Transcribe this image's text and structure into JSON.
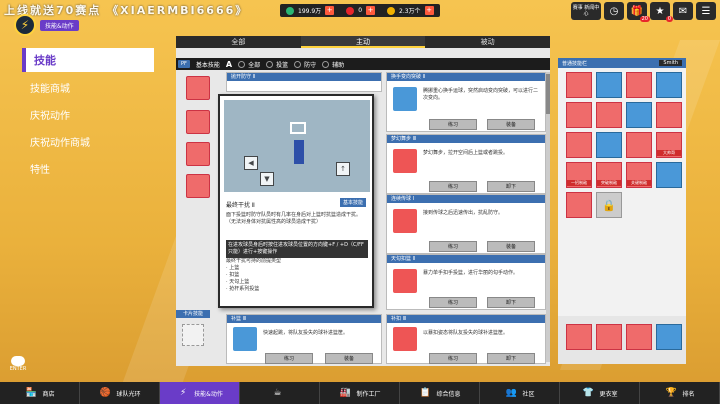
{
  "watermark": "上线就送70赛点 《XIAERMBI6666》",
  "logo": {
    "glyph": "⚡",
    "subtitle": "技能&动作"
  },
  "currencies": [
    {
      "value": "199.9万",
      "color": "#2bb673",
      "add_label": "+"
    },
    {
      "value": "0",
      "color": "#e8252b",
      "add_label": "+"
    },
    {
      "value": "2.3万个",
      "color": "#f0b000",
      "add_label": "+"
    }
  ],
  "top_icons": [
    {
      "name": "league-icon",
      "glyph": "赛事\n新闻中心",
      "badge": ""
    },
    {
      "name": "clock-icon",
      "glyph": "◷",
      "badge": ""
    },
    {
      "name": "gift-icon",
      "glyph": "🎁",
      "badge": "20"
    },
    {
      "name": "reward-icon",
      "glyph": "★",
      "badge": "0"
    },
    {
      "name": "mail-icon",
      "glyph": "✉",
      "badge": ""
    },
    {
      "name": "menu-icon",
      "glyph": "☰",
      "badge": ""
    }
  ],
  "sidebar": {
    "items": [
      {
        "label": "技能",
        "active": true
      },
      {
        "label": "技能商城",
        "active": false
      },
      {
        "label": "庆祝动作",
        "active": false
      },
      {
        "label": "庆祝动作商城",
        "active": false
      },
      {
        "label": "特性",
        "active": false
      }
    ]
  },
  "tabs": [
    {
      "label": "全部",
      "active": false
    },
    {
      "label": "主动",
      "active": true
    },
    {
      "label": "被动",
      "active": false
    }
  ],
  "filter": {
    "base_label": "基本技能",
    "letter": "A",
    "items": [
      "全部",
      "投篮",
      "防守",
      "辅助"
    ]
  },
  "cards": [
    {
      "header": "抛开防守 Ⅱ",
      "desc": "",
      "btn1": "练习",
      "btn2": "装备"
    },
    {
      "header": "换手变向突破 Ⅱ",
      "desc": "腾挪重心换手运球，突然启动变向突破，可以进行二次变向。",
      "btn1": "练习",
      "btn2": "装备"
    },
    {
      "header": "梦幻舞步 Ⅲ",
      "desc": "梦幻舞步，拉开空间后上篮或者跳投。",
      "btn1": "练习",
      "btn2": "卸下"
    },
    {
      "header": "连续传球 Ⅰ",
      "desc": "接到传球之后迅速传出，抗乱防守。",
      "btn1": "练习",
      "btn2": "装备"
    },
    {
      "header": "天勾扣篮 Ⅱ",
      "desc": "暴力单手扣手投篮，进行华丽的勾手动作。",
      "btn1": "练习",
      "btn2": "卸下"
    },
    {
      "header": "补篮 Ⅲ",
      "desc": "快速起跳，将队友投失的球补进篮筐。",
      "btn1": "练习",
      "btn2": "装备"
    },
    {
      "header": "补扣 Ⅲ",
      "desc": "以暴扣姿态将队友投失的球补进篮筐。",
      "btn1": "练习",
      "btn2": "卸下"
    }
  ],
  "popup": {
    "title": "最终干扰 Ⅱ",
    "tag": "基本技能",
    "desc": "面下投篮时防守队员时有几率在身后对上篮时抗篮造成干扰。（无法对身体对抗属性高的球员造成干扰）",
    "control": "在进攻球员身后时按住进攻球员位置的方向键+F / +D（C/FF只能）进行+按键操作",
    "bullets_title": "最终干扰可持的前提类型",
    "bullets": [
      "上篮",
      "扣篮",
      "天勾上篮",
      "抢杆系列投篮"
    ]
  },
  "card_skill_label": "卡片技能",
  "right_panel": {
    "title": "普通技能栏",
    "select": "Smith",
    "labels": [
      "一招制敌",
      "突破制敌",
      "关键制敌",
      "大帅哥"
    ]
  },
  "enter_label": "ENTER",
  "bottom_nav": [
    {
      "label": "商店",
      "icon": "🏪",
      "active": false
    },
    {
      "label": "球队光环",
      "icon": "🏀",
      "active": false
    },
    {
      "label": "技能&动作",
      "icon": "⚡",
      "active": true
    },
    {
      "label": "",
      "icon": "☕",
      "active": false
    },
    {
      "label": "制作工厂",
      "icon": "🏭",
      "active": false
    },
    {
      "label": "综合信息",
      "icon": "📋",
      "active": false
    },
    {
      "label": "社区",
      "icon": "👥",
      "active": false
    },
    {
      "label": "更衣室",
      "icon": "👕",
      "active": false
    },
    {
      "label": "排名",
      "icon": "🏆",
      "active": false
    }
  ]
}
